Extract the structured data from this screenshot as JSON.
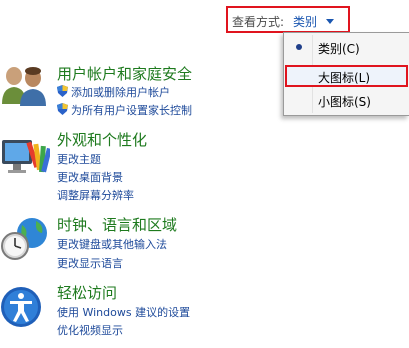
{
  "view": {
    "label": "查看方式:",
    "selected": "类别"
  },
  "menu": {
    "items": [
      {
        "label": "类别(C)",
        "checked": true
      },
      {
        "label": "大图标(L)",
        "checked": false
      },
      {
        "label": "小图标(S)",
        "checked": false
      }
    ]
  },
  "categories": [
    {
      "title": "用户帐户和家庭安全",
      "icon": "users-icon",
      "links": [
        "添加或删除用户帐户",
        "为所有用户设置家长控制"
      ]
    },
    {
      "title": "外观和个性化",
      "icon": "appearance-icon",
      "links": [
        "更改主题",
        "更改桌面背景",
        "调整屏幕分辨率"
      ]
    },
    {
      "title": "时钟、语言和区域",
      "icon": "clock-globe-icon",
      "links": [
        "更改键盘或其他输入法",
        "更改显示语言"
      ]
    },
    {
      "title": "轻松访问",
      "icon": "ease-of-access-icon",
      "links": [
        "使用 Windows 建议的设置",
        "优化视频显示"
      ]
    }
  ],
  "colors": {
    "category_title": "#1e7a1e",
    "link": "#1e4a9a",
    "highlight_border": "#e0141e"
  }
}
